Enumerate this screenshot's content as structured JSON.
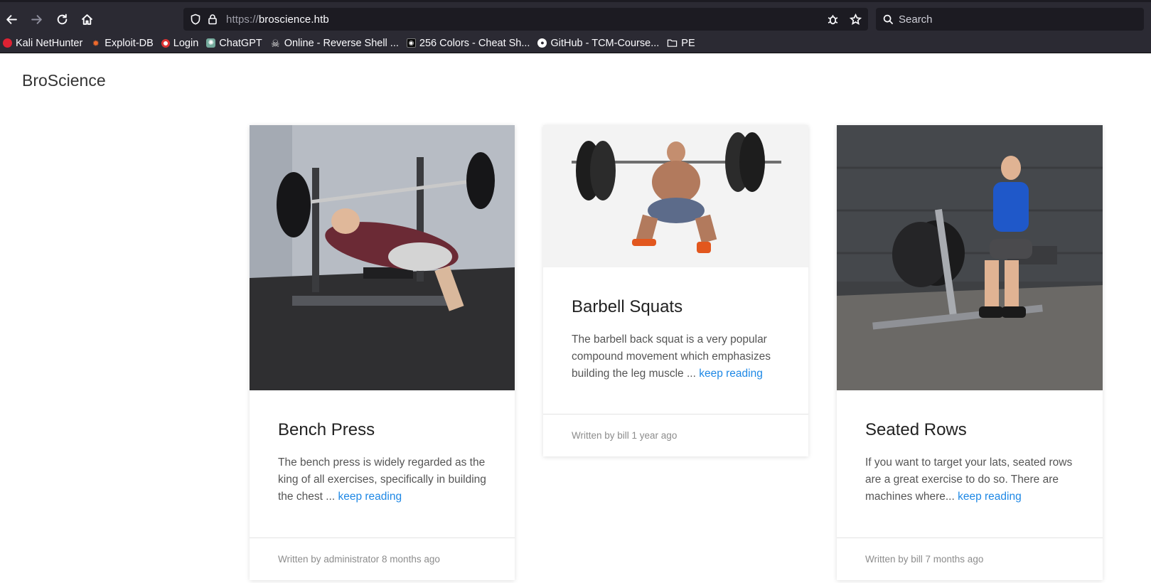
{
  "browser": {
    "url_protocol": "https://",
    "url_host": "broscience.htb",
    "search_placeholder": "Search",
    "bookmarks": [
      {
        "label": "Kali NetHunter",
        "icon": "kali-icon"
      },
      {
        "label": "Exploit-DB",
        "icon": "exploitdb-icon"
      },
      {
        "label": "Login",
        "icon": "login-icon"
      },
      {
        "label": "ChatGPT",
        "icon": "chatgpt-icon"
      },
      {
        "label": "Online - Reverse Shell ...",
        "icon": "skull-icon"
      },
      {
        "label": "256 Colors - Cheat Sh...",
        "icon": "colors-icon"
      },
      {
        "label": "GitHub - TCM-Course...",
        "icon": "github-icon"
      },
      {
        "label": "PE",
        "icon": "folder-icon"
      }
    ]
  },
  "site": {
    "brand": "BroScience"
  },
  "posts": [
    {
      "title": "Bench Press",
      "excerpt": "The bench press is widely regarded as the king of all exercises, specifically in building the chest ...",
      "link": "keep reading",
      "meta": "Written by administrator 8 months ago"
    },
    {
      "title": "Barbell Squats",
      "excerpt": "The barbell back squat is a very popular compound movement which emphasizes building the leg muscle ...",
      "link": "keep reading",
      "meta": "Written by bill 1 year ago"
    },
    {
      "title": "Seated Rows",
      "excerpt": "If you want to target your lats, seated rows are a great exercise to do so. There are machines where...",
      "link": "keep reading",
      "meta": "Written by bill 7 months ago"
    }
  ],
  "colors": {
    "toolbar_bg": "#2b2a33",
    "link": "#1e88e5"
  }
}
